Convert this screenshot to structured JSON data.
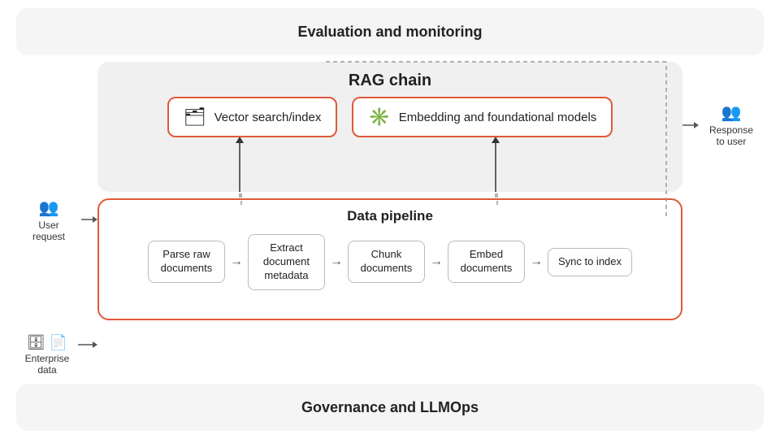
{
  "diagram": {
    "eval_label": "Evaluation and monitoring",
    "gov_label": "Governance and LLMOps",
    "rag_label": "RAG chain",
    "pipeline_label": "Data pipeline",
    "chips": [
      {
        "id": "vector",
        "icon": "🗂",
        "label": "Vector search/index"
      },
      {
        "id": "embedding",
        "icon": "✳",
        "label": "Embedding and foundational models"
      }
    ],
    "pipeline_steps": [
      {
        "id": "parse",
        "label": "Parse raw\ndocuments"
      },
      {
        "id": "extract",
        "label": "Extract\ndocument\nmetadata"
      },
      {
        "id": "chunk",
        "label": "Chunk\ndocuments"
      },
      {
        "id": "embed",
        "label": "Embed\ndocuments"
      },
      {
        "id": "sync",
        "label": "Sync to index"
      }
    ],
    "user_request_label": "User\nrequest",
    "response_label": "Response\nto user",
    "enterprise_label": "Enterprise\ndata"
  }
}
